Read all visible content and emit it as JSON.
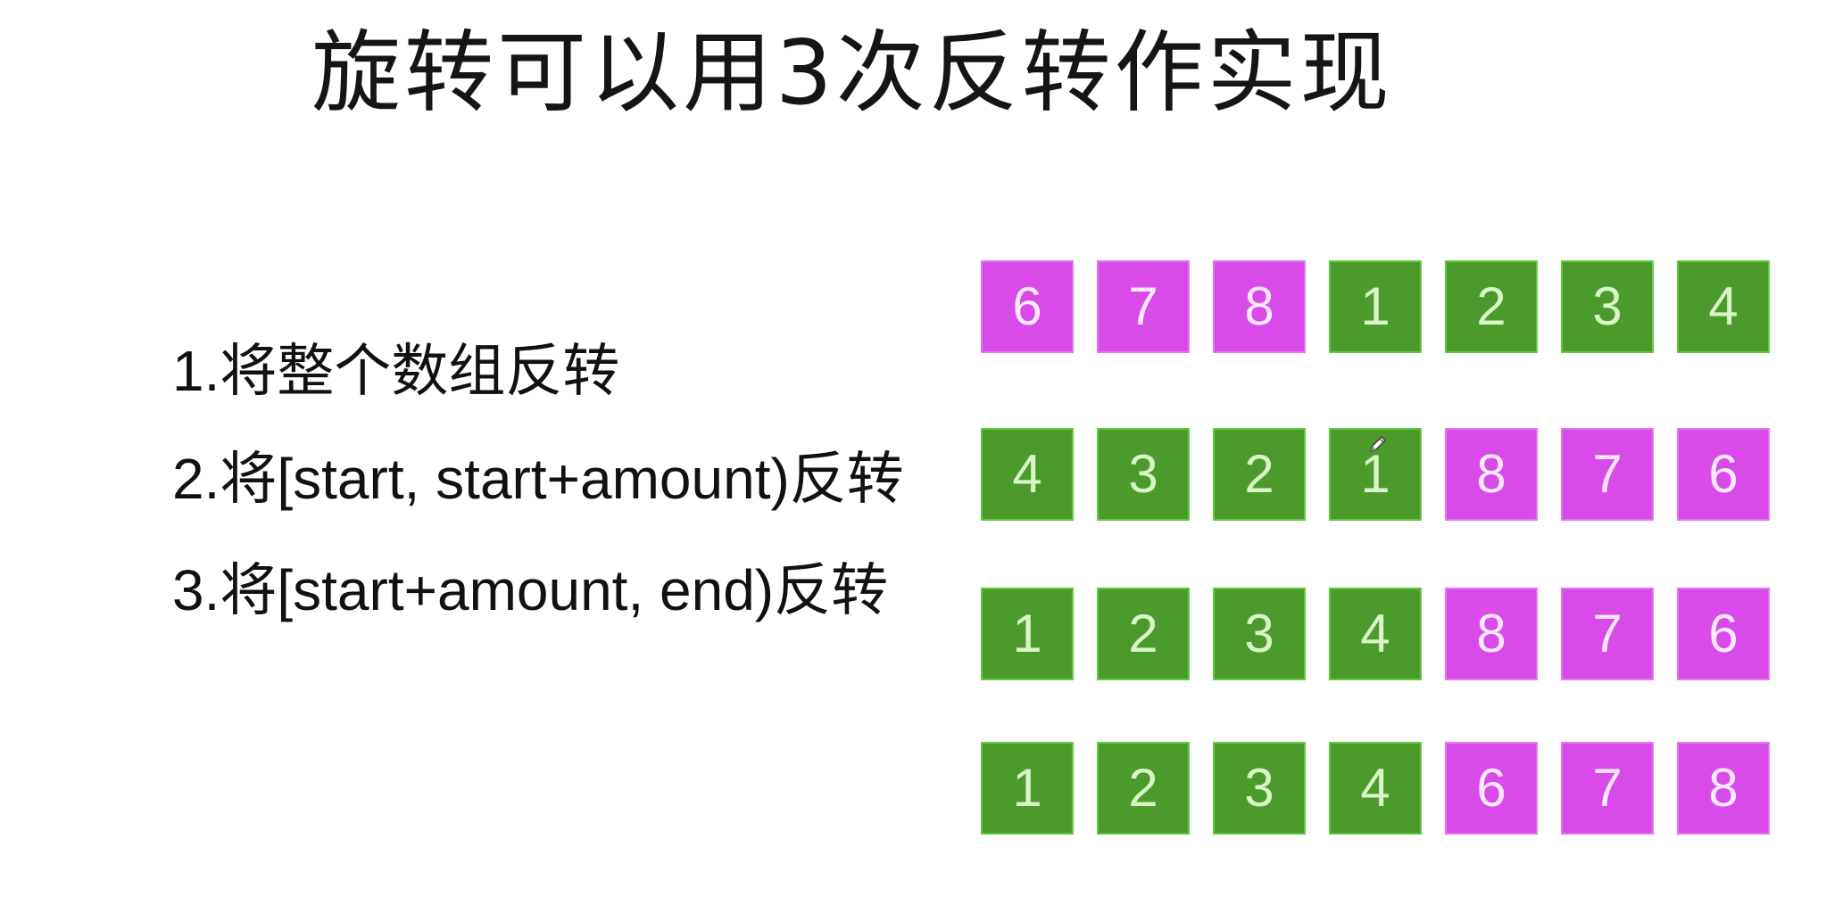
{
  "title": "旋转可以用3次反转作实现",
  "steps": [
    "1.将整个数组反转",
    "2.将[start, start+amount)反转",
    "3.将[start+amount, end)反转"
  ],
  "colors": {
    "magenta": "#d84be9",
    "magenta_border": "#e273f1",
    "magenta_text": "#fbe8ff",
    "green": "#4a9b2c",
    "green_border": "#62c93e",
    "green_text": "#d9f7c6"
  },
  "cursor_icon": "pen-cursor-icon",
  "rows": [
    {
      "cells": [
        {
          "value": "6",
          "color": "magenta"
        },
        {
          "value": "7",
          "color": "magenta"
        },
        {
          "value": "8",
          "color": "magenta"
        },
        {
          "value": "1",
          "color": "green"
        },
        {
          "value": "2",
          "color": "green"
        },
        {
          "value": "3",
          "color": "green"
        },
        {
          "value": "4",
          "color": "green"
        }
      ]
    },
    {
      "cells": [
        {
          "value": "4",
          "color": "green"
        },
        {
          "value": "3",
          "color": "green"
        },
        {
          "value": "2",
          "color": "green"
        },
        {
          "value": "1",
          "color": "green"
        },
        {
          "value": "8",
          "color": "magenta"
        },
        {
          "value": "7",
          "color": "magenta"
        },
        {
          "value": "6",
          "color": "magenta"
        }
      ]
    },
    {
      "cells": [
        {
          "value": "1",
          "color": "green"
        },
        {
          "value": "2",
          "color": "green"
        },
        {
          "value": "3",
          "color": "green"
        },
        {
          "value": "4",
          "color": "green"
        },
        {
          "value": "8",
          "color": "magenta"
        },
        {
          "value": "7",
          "color": "magenta"
        },
        {
          "value": "6",
          "color": "magenta"
        }
      ]
    },
    {
      "cells": [
        {
          "value": "1",
          "color": "green"
        },
        {
          "value": "2",
          "color": "green"
        },
        {
          "value": "3",
          "color": "green"
        },
        {
          "value": "4",
          "color": "green"
        },
        {
          "value": "6",
          "color": "magenta"
        },
        {
          "value": "7",
          "color": "magenta"
        },
        {
          "value": "8",
          "color": "magenta"
        }
      ]
    }
  ]
}
